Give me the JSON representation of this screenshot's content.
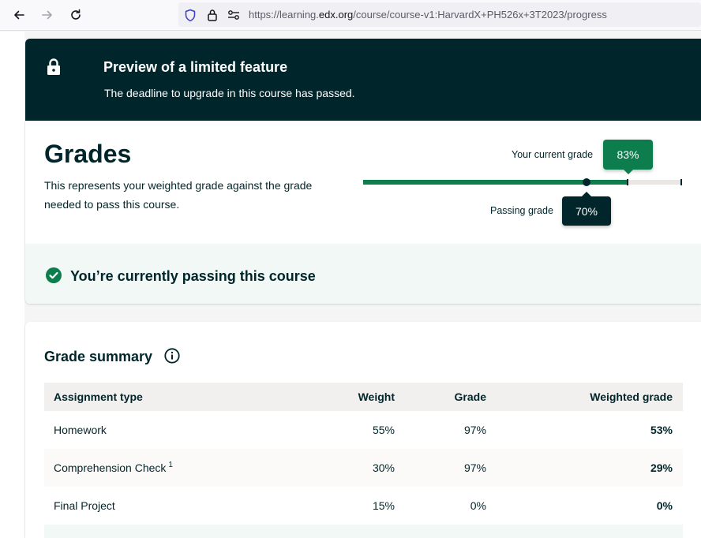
{
  "browser": {
    "url_prefix": "https://learning.",
    "url_host": "edx.org",
    "url_path": "/course/course-v1:HarvardX+PH526x+3T2023/progress"
  },
  "banner": {
    "title": "Preview of a limited feature",
    "subtitle": "The deadline to upgrade in this course has passed."
  },
  "grades": {
    "title": "Grades",
    "description": "This represents your weighted grade against the grade needed to pass this course.",
    "current_label": "Your current grade",
    "current_value": "83%",
    "current_fraction": 0.83,
    "passing_label": "Passing grade",
    "passing_value": "70%",
    "passing_fraction": 0.7,
    "status": "You’re currently passing this course"
  },
  "summary": {
    "title": "Grade summary",
    "columns": [
      "Assignment type",
      "Weight",
      "Grade",
      "Weighted grade"
    ],
    "rows": [
      {
        "type": "Homework",
        "footnote": "",
        "weight": "55%",
        "grade": "97%",
        "weighted": "53%"
      },
      {
        "type": "Comprehension Check",
        "footnote": "1",
        "weight": "30%",
        "grade": "97%",
        "weighted": "29%"
      },
      {
        "type": "Final Project",
        "footnote": "",
        "weight": "15%",
        "grade": "0%",
        "weighted": "0%"
      }
    ]
  },
  "colors": {
    "brand_dark": "#00262b",
    "success": "#0d7d4d",
    "success_bg": "#f1f8f5"
  },
  "icons": [
    "back-arrow-icon",
    "forward-arrow-icon",
    "reload-icon",
    "shield-icon",
    "lock-icon",
    "permissions-icon",
    "check-circle-icon",
    "info-icon"
  ]
}
